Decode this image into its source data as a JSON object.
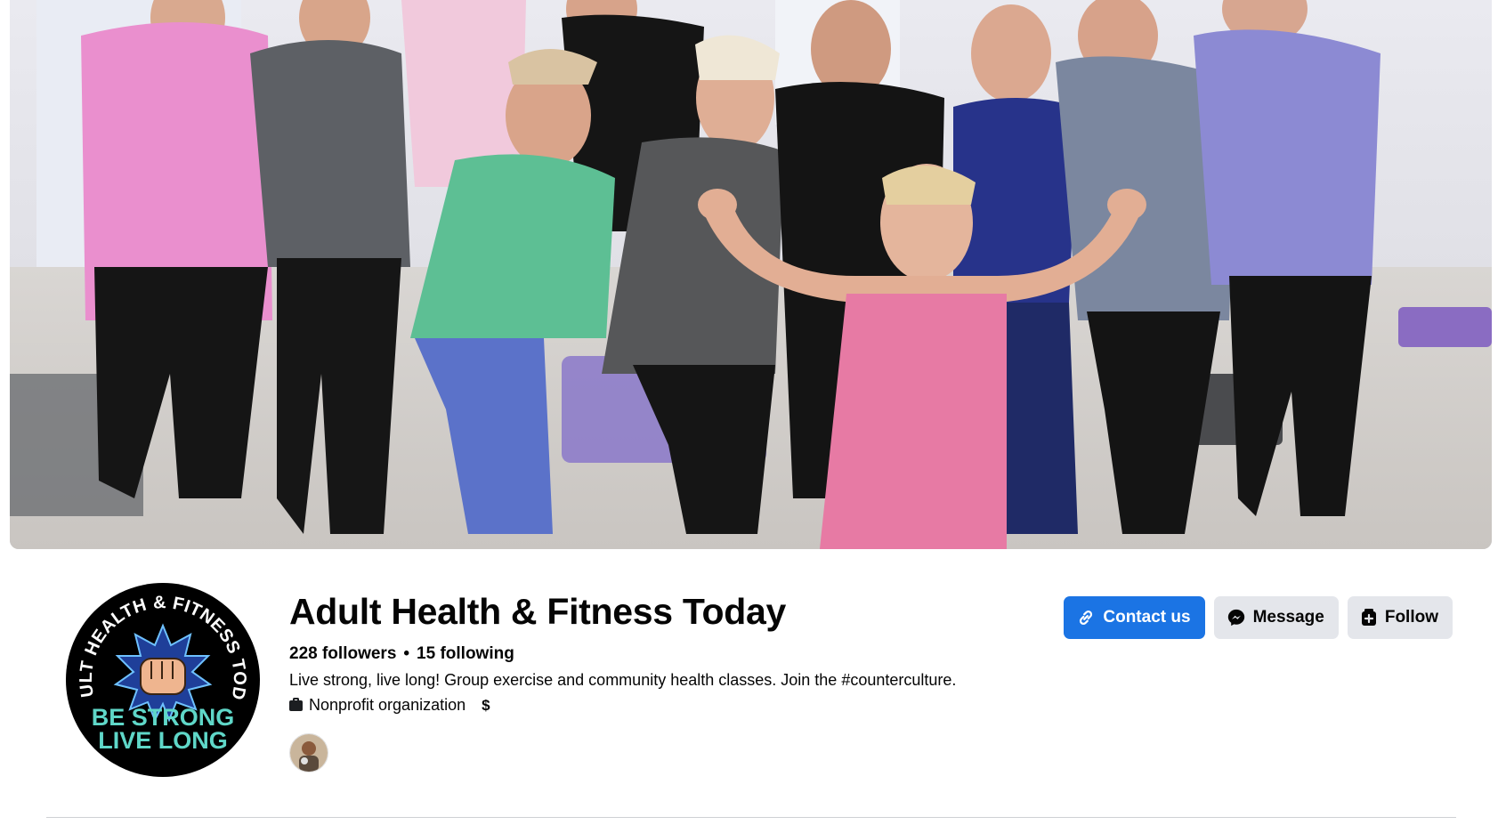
{
  "page": {
    "title": "Adult Health & Fitness Today",
    "followers": "228 followers",
    "separator": "•",
    "following": "15 following",
    "bio": "Live strong, live long! Group exercise and community health classes. Join the #counterculture.",
    "category": "Nonprofit organization",
    "price_range": "$"
  },
  "actions": {
    "contact_label": "Contact us",
    "message_label": "Message",
    "follow_label": "Follow"
  },
  "logo": {
    "arc_text": "ADULT HEALTH & FITNESS TODAY",
    "line1": "BE STRONG",
    "line2": "LIVE LONG"
  },
  "icons": {
    "contact": "link-icon",
    "message": "messenger-icon",
    "follow": "follow-page-icon",
    "category": "briefcase-icon"
  },
  "colors": {
    "primary": "#1b74e4",
    "secondary": "#e4e6eb",
    "text": "#050505",
    "logo_teal": "#5fd7c8"
  }
}
